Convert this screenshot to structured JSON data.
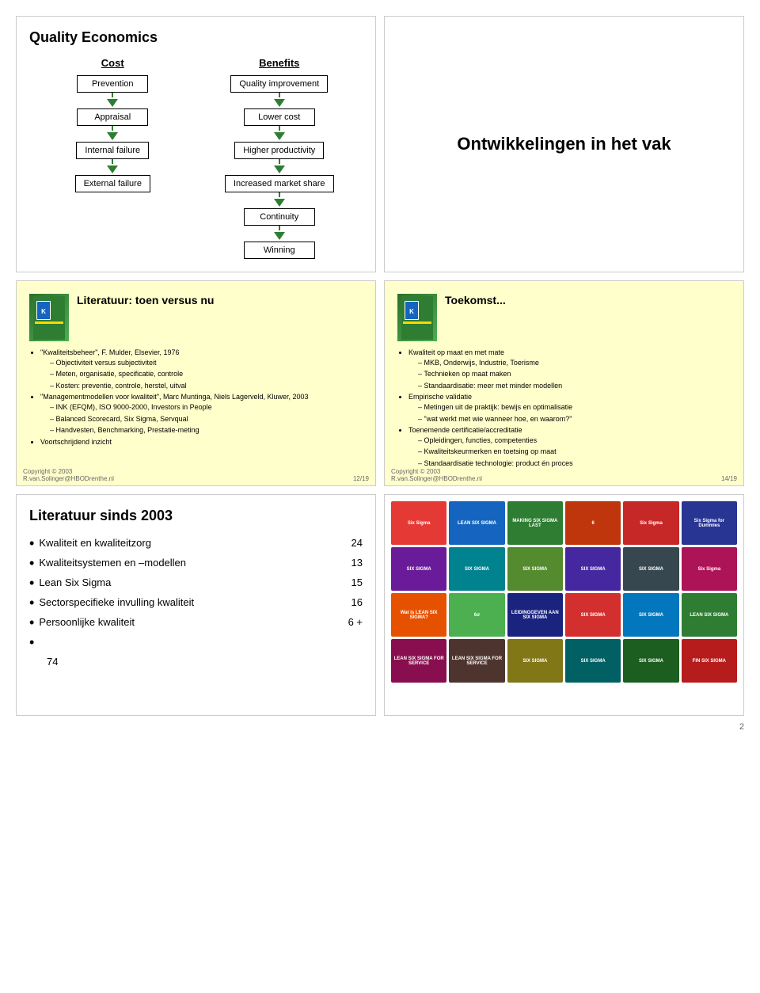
{
  "page": {
    "number": "2"
  },
  "slide1": {
    "title": "Quality Economics",
    "cost_title": "Cost",
    "benefits_title": "Benefits",
    "cost_items": [
      "Prevention",
      "Appraisal",
      "Internal failure",
      "External failure"
    ],
    "benefits_items": [
      "Quality improvement",
      "Lower cost",
      "Higher productivity",
      "Increased market share",
      "Continuity",
      "Winning"
    ]
  },
  "slide2": {
    "title": "Ontwikkelingen in het vak"
  },
  "slide3": {
    "title": "Literatuur: toen versus nu",
    "items": [
      {
        "main": "\"Kwaliteitsbeheer\", F. Mulder, Elsevier, 1976",
        "sub": [
          "Objectiviteit versus subjectiviteit",
          "Meten, organisatie, specificatie, controle",
          "Kosten: preventie, controle, herstel, uitval"
        ]
      },
      {
        "main": "\"Managementmodellen voor kwaliteit\", Marc Muntinga, Niels Lagerveld, Kluwer, 2003",
        "sub": [
          "INK (EFQM), ISO 9000-2000, Investors in People",
          "Balanced Scorecard, Six Sigma, Servqual",
          "Handvesten, Benchmarking, Prestatie-meting"
        ]
      },
      {
        "main": "Voortschrijdend inzicht",
        "sub": []
      }
    ],
    "slide_number": "12/19",
    "copyright": "Copyright © 2003",
    "email": "R.van.Solinger@HBODrenthe.nl"
  },
  "slide4": {
    "title": "Toekomst...",
    "items": [
      {
        "main": "Kwaliteit op maat en met mate",
        "sub": [
          "MKB, Onderwijs, Industrie, Toerisme",
          "Technieken op maat maken",
          "Standaardisatie: meer met minder modellen"
        ]
      },
      {
        "main": "Empirische validatie",
        "sub": [
          "Metingen uit de praktijk: bewijs en optimalisatie",
          "\"wat werkt met wie wanneer hoe, en waarom?\""
        ]
      },
      {
        "main": "Toenemende certificatie/accreditatie",
        "sub": [
          "Opleidingen, functies, competenties",
          "Kwaliteitskeurmerken en toetsing op maat",
          "Standaardisatie technologie: product én proces"
        ]
      }
    ],
    "slide_number": "14/19",
    "copyright": "Copyright © 2003",
    "email": "R.van.Solinger@HBODrenthe.nl"
  },
  "slide5": {
    "title": "Literatuur sinds 2003",
    "items": [
      {
        "label": "Kwaliteit en kwaliteitzorg",
        "count": "24"
      },
      {
        "label": "Kwaliteitsystemen en –modellen",
        "count": "13"
      },
      {
        "label": "Lean Six Sigma",
        "count": "15"
      },
      {
        "label": "Sectorspecifieke invulling kwaliteit",
        "count": "16"
      },
      {
        "label": "Persoonlijke kwaliteit",
        "count": "6 +"
      }
    ],
    "total": "74"
  },
  "slide6": {
    "books": [
      {
        "color": "#e53935",
        "label": "Six Sigma"
      },
      {
        "color": "#1565c0",
        "label": "LEAN SIX SIGMA"
      },
      {
        "color": "#2e7d32",
        "label": "MAKING SIX SIGMA LAST"
      },
      {
        "color": "#bf360c",
        "label": "6"
      },
      {
        "color": "#c62828",
        "label": "Six Sigma"
      },
      {
        "color": "#283593",
        "label": "Six Sigma for Dummies"
      },
      {
        "color": "#6a1b9a",
        "label": "SIX SIGMA"
      },
      {
        "color": "#00838f",
        "label": "SIX SIGMA"
      },
      {
        "color": "#558b2f",
        "label": "SIX SIGMA"
      },
      {
        "color": "#4527a0",
        "label": "SIX SIGMA"
      },
      {
        "color": "#37474f",
        "label": "SIX SIGMA"
      },
      {
        "color": "#ad1457",
        "label": "Six Sigma"
      },
      {
        "color": "#e65100",
        "label": "Wat is LEAN SIX SIGMA?"
      },
      {
        "color": "#4caf50",
        "label": "6σ"
      },
      {
        "color": "#1a237e",
        "label": "LEIDINGGEVEN AAN SIX SIGMA"
      },
      {
        "color": "#d32f2f",
        "label": "SIX SIGMA"
      },
      {
        "color": "#0277bd",
        "label": "SIX SIGMA"
      },
      {
        "color": "#2e7d32",
        "label": "LEAN SIX SIGMA"
      },
      {
        "color": "#880e4f",
        "label": "LEAN SIX SIGMA FOR SERVICE"
      },
      {
        "color": "#4e342e",
        "label": "LEAN SIX SIGMA FOR SERVICE"
      },
      {
        "color": "#827717",
        "label": "SIX SIGMA"
      },
      {
        "color": "#006064",
        "label": "SIX SIGMA"
      },
      {
        "color": "#1b5e20",
        "label": "SIX SIGMA"
      },
      {
        "color": "#b71c1c",
        "label": "FIN SIX SIGMA"
      }
    ]
  }
}
